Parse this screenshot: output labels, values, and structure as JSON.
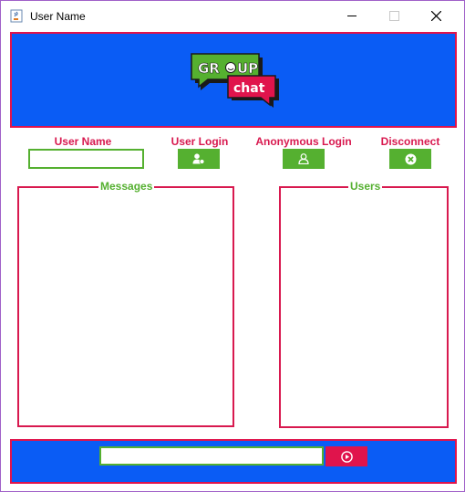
{
  "window": {
    "title": "User Name",
    "icon": "java-cup-icon",
    "controls": [
      "minimize-icon",
      "maximize-icon",
      "close-icon"
    ]
  },
  "header": {
    "logo": {
      "line1": "GR",
      "line1b": "UP",
      "line2": "chat"
    }
  },
  "login_row": {
    "username_label": "User Name",
    "username_value": "",
    "user_login_label": "User Login",
    "user_login_icon": "user-login-icon",
    "anonymous_login_label": "Anonymous Login",
    "anonymous_login_icon": "anonymous-user-icon",
    "disconnect_label": "Disconnect",
    "disconnect_icon": "cancel-circle-icon"
  },
  "panels": {
    "messages_title": "Messages",
    "users_title": "Users"
  },
  "footer": {
    "message_value": "",
    "send_icon": "play-circle-icon"
  },
  "colors": {
    "accent_blue": "#0a5cf5",
    "border_pink": "#e0144c",
    "label_pink": "#d8194f",
    "button_green": "#55b030"
  }
}
